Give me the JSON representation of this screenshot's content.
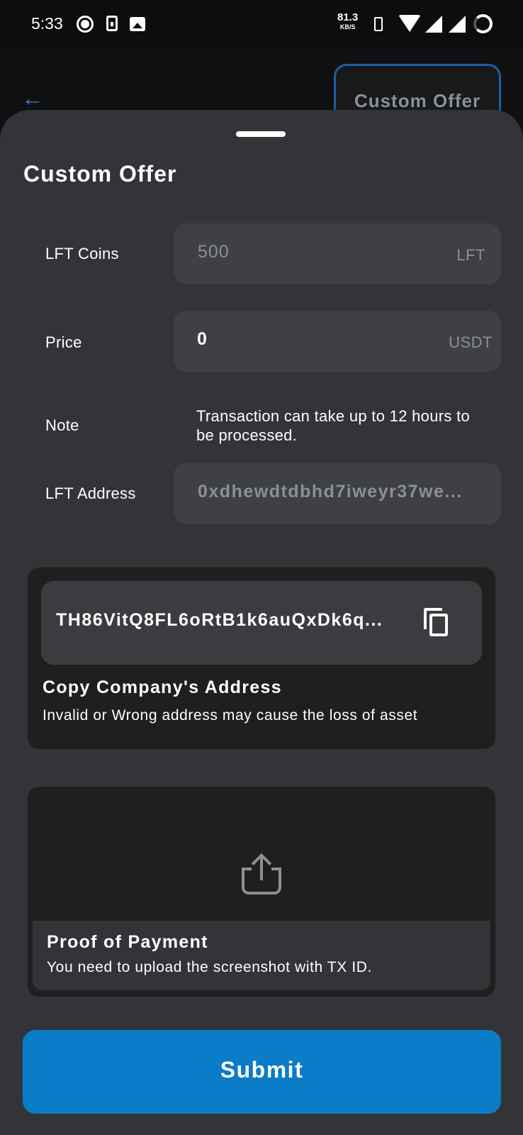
{
  "status_bar": {
    "time": "5:33",
    "speed_value": "81.3",
    "speed_unit": "KB/S"
  },
  "header": {
    "title": "Custom Offer"
  },
  "sheet": {
    "title": "Custom Offer",
    "rows": {
      "coins": {
        "label": "LFT Coins",
        "placeholder": "500",
        "suffix": "LFT"
      },
      "price": {
        "label": "Price",
        "value": "0",
        "suffix": "USDT"
      },
      "note": {
        "label": "Note",
        "text": "Transaction can take up to 12 hours to be processed."
      },
      "address": {
        "label": "LFT Address",
        "placeholder": "0xdhewdtdbhd7iweyr37we..."
      }
    },
    "company_address": {
      "address": "TH86VitQ8FL6oRtB1k6auQxDk6q...",
      "title": "Copy Company's Address",
      "subtitle": "Invalid or Wrong address may cause the loss of asset"
    },
    "proof": {
      "title": "Proof of Payment",
      "subtitle": "You need to upload the screenshot with TX ID."
    },
    "submit_label": "Submit"
  },
  "colors": {
    "accent": "#0a7cc8",
    "sheet_bg": "#323437",
    "card_bg": "#1f1f20",
    "field_bg": "#3e4043",
    "muted_text": "#8c9095"
  }
}
